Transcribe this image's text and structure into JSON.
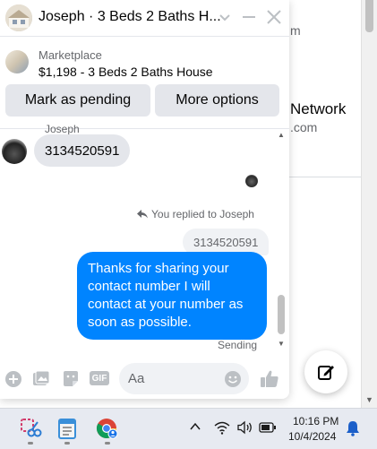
{
  "background": {
    "fragments": [
      "m",
      "Network",
      ".com"
    ]
  },
  "chat": {
    "header": {
      "title": "Joseph · 3 Beds 2 Baths H..."
    },
    "listing": {
      "source": "Marketplace",
      "title": "$1,198 - 3 Beds 2 Baths House",
      "actions": [
        "Mark as pending",
        "More options"
      ]
    },
    "messages": {
      "sender_name": "Joseph",
      "incoming": "3134520591",
      "reply_note": "You replied to Joseph",
      "quoted": "3134520591",
      "outgoing": "Thanks for sharing your contact number I will contact at your number as soon as possible.",
      "status": "Sending"
    },
    "composer": {
      "placeholder": "Aa",
      "gif_label": "GIF"
    }
  },
  "taskbar": {
    "time": "10:16 PM",
    "date": "10/4/2024"
  },
  "colors": {
    "accent": "#0084ff",
    "bubble_gray": "#e4e6eb",
    "icon_gray": "#bcc0c4"
  }
}
